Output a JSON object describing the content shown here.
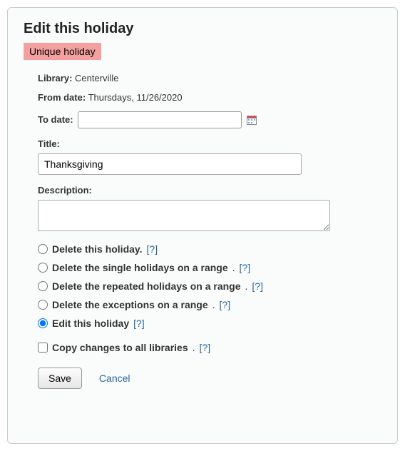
{
  "heading": "Edit this holiday",
  "badge": "Unique holiday",
  "library": {
    "label": "Library:",
    "value": "Centerville"
  },
  "from_date": {
    "label": "From date:",
    "value": "Thursdays, 11/26/2020"
  },
  "to_date": {
    "label": "To date:",
    "value": ""
  },
  "title_field": {
    "label": "Title:",
    "value": "Thanksgiving"
  },
  "description_field": {
    "label": "Description:",
    "value": ""
  },
  "options": [
    {
      "label": "Delete this holiday.",
      "help": "[?]",
      "checked": false
    },
    {
      "label": "Delete the single holidays on a range",
      "help": "[?]",
      "dot": ".",
      "checked": false
    },
    {
      "label": "Delete the repeated holidays on a range",
      "help": "[?]",
      "dot": ".",
      "checked": false
    },
    {
      "label": "Delete the exceptions on a range",
      "help": "[?]",
      "dot": ".",
      "checked": false
    },
    {
      "label": "Edit this holiday",
      "help": "[?]",
      "checked": true
    }
  ],
  "copy_all": {
    "label": "Copy changes to all libraries",
    "help": "[?]",
    "dot": ".",
    "checked": false
  },
  "actions": {
    "save": "Save",
    "cancel": "Cancel"
  }
}
